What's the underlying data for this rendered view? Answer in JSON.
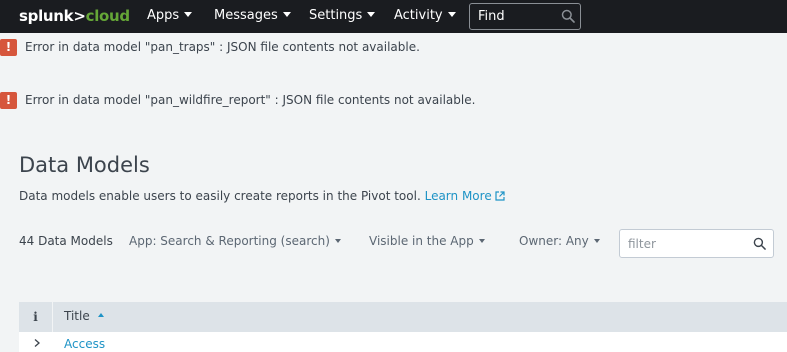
{
  "nav": {
    "logo_prefix": "splunk>",
    "logo_suffix": "cloud",
    "items": [
      {
        "label": "Apps"
      },
      {
        "label": "Messages"
      },
      {
        "label": "Settings"
      },
      {
        "label": "Activity"
      }
    ],
    "find_placeholder": "Find"
  },
  "errors": [
    {
      "text": "Error in data model \"pan_traps\" : JSON file contents not available."
    },
    {
      "text": "Error in data model \"pan_wildfire_report\" : JSON file contents not available."
    }
  ],
  "page": {
    "title": "Data Models",
    "description": "Data models enable users to easily create reports in the Pivot tool.",
    "learn_more": "Learn More"
  },
  "filters": {
    "count": "44 Data Models",
    "app": "App: Search & Reporting (search)",
    "visibility": "Visible in the App",
    "owner": "Owner: Any",
    "filter_placeholder": "filter"
  },
  "table": {
    "columns": {
      "info": "i",
      "title": "Title"
    },
    "rows": [
      {
        "title": "Access"
      }
    ]
  },
  "colors": {
    "topbar": "#1a1c20",
    "brand_green": "#65a637",
    "error_red": "#d6563c",
    "link_blue": "#1e93c6",
    "page_bg": "#f2f4f5",
    "table_header_bg": "#dde3e8"
  }
}
